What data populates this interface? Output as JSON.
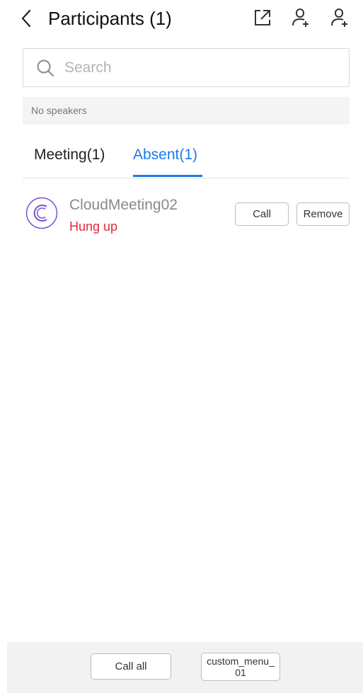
{
  "header": {
    "title": "Participants (1)",
    "icons": [
      "back-icon",
      "share-external-icon",
      "add-participant-icon",
      "invite-participant-icon"
    ]
  },
  "search": {
    "placeholder": "Search",
    "value": ""
  },
  "speakers": {
    "text": "No speakers"
  },
  "tabs": [
    {
      "label": "Meeting(1)",
      "active": false
    },
    {
      "label": "Absent(1)",
      "active": true
    }
  ],
  "participants": [
    {
      "name": "CloudMeeting02",
      "status": "Hung up",
      "call_label": "Call",
      "remove_label": "Remove"
    }
  ],
  "footer": {
    "call_all_label": "Call all",
    "custom_menu_label": "custom_menu_01"
  },
  "colors": {
    "accent": "#1a7ae8",
    "status_hung_up": "#e02b3a",
    "avatar_ring": "#7b4fd6"
  }
}
